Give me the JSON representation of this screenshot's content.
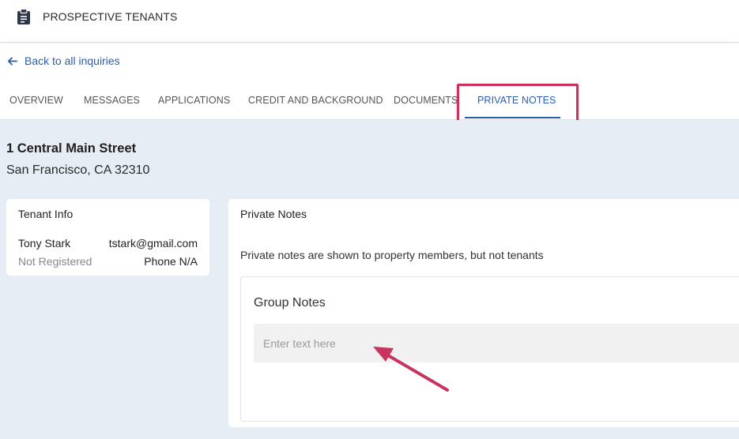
{
  "header": {
    "title": "PROSPECTIVE TENANTS",
    "icon": "clipboard-icon"
  },
  "back_link": {
    "label": "Back to all inquiries",
    "icon": "arrow-left-icon"
  },
  "tabs": [
    {
      "label": "OVERVIEW",
      "active": false
    },
    {
      "label": "MESSAGES",
      "active": false
    },
    {
      "label": "APPLICATIONS",
      "active": false
    },
    {
      "label": "CREDIT AND BACKGROUND",
      "active": false
    },
    {
      "label": "DOCUMENTS",
      "active": false
    },
    {
      "label": "PRIVATE NOTES",
      "active": true
    }
  ],
  "property": {
    "street": "1 Central Main Street",
    "city": "San Francisco, CA 32310"
  },
  "tenant_info": {
    "title": "Tenant Info",
    "name": "Tony Stark",
    "email": "tstark@gmail.com",
    "status": "Not Registered",
    "phone": "Phone N/A"
  },
  "private_notes": {
    "title": "Private Notes",
    "description": "Private notes are shown to property members, but not tenants",
    "group_notes": {
      "title": "Group Notes",
      "placeholder": "Enter text here",
      "value": ""
    }
  },
  "colors": {
    "accent": "#2a5db0",
    "highlight": "#c8345d",
    "background": "#e7edf4"
  }
}
